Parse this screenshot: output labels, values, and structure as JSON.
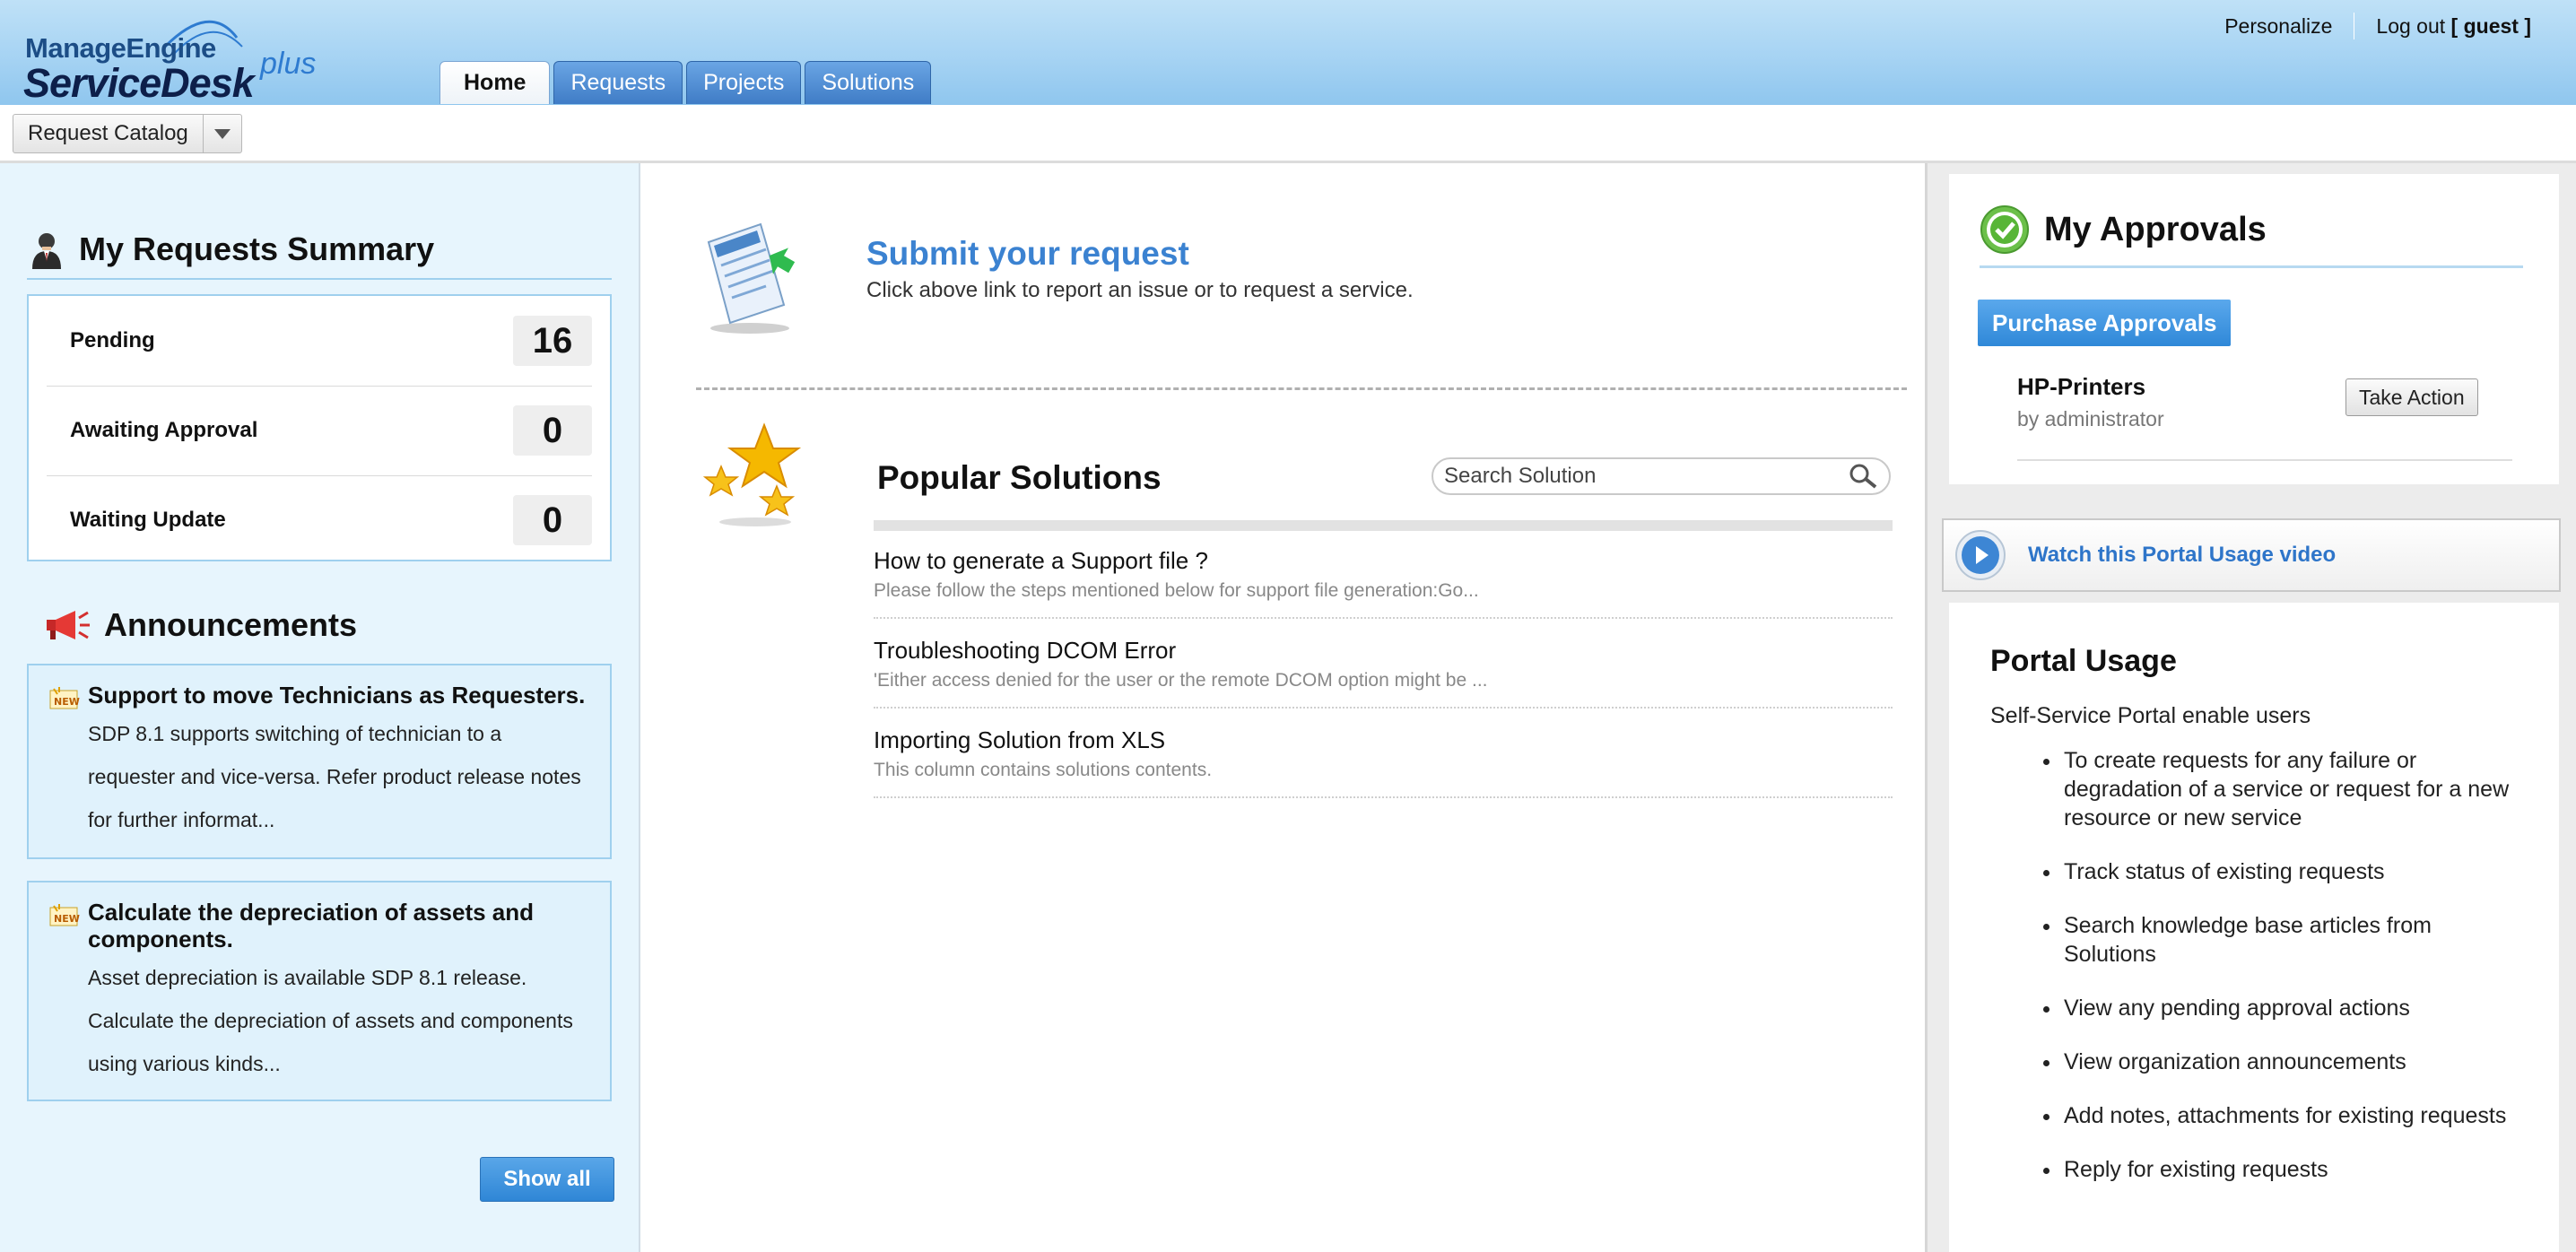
{
  "brand": {
    "line1": "ManageEngine",
    "line2": "ServiceDesk",
    "suffix": "plus"
  },
  "tabs": [
    {
      "label": "Home",
      "active": true
    },
    {
      "label": "Requests"
    },
    {
      "label": "Projects"
    },
    {
      "label": "Solutions"
    }
  ],
  "toplinks": {
    "personalize": "Personalize",
    "logout": "Log out",
    "user": "[ guest ]"
  },
  "toolbar": {
    "catalog_label": "Request Catalog"
  },
  "requests_summary": {
    "title": "My Requests Summary",
    "rows": [
      {
        "label": "Pending",
        "count": "16"
      },
      {
        "label": "Awaiting Approval",
        "count": "0"
      },
      {
        "label": "Waiting Update",
        "count": "0"
      }
    ]
  },
  "announcements": {
    "title": "Announcements",
    "items": [
      {
        "title": "Support to move Technicians as Requesters.",
        "text": "SDP 8.1 supports switching of technician to a requester and vice-versa. Refer product release notes for further informat..."
      },
      {
        "title": "Calculate the depreciation of assets and components.",
        "text": "Asset depreciation is available SDP 8.1 release. Calculate the depreciation of assets and components using various kinds..."
      }
    ],
    "show_all": "Show all"
  },
  "submit": {
    "link": "Submit your request",
    "desc": "Click above link to report an issue or to request a service."
  },
  "popular": {
    "title": "Popular Solutions",
    "search_placeholder": "Search Solution",
    "solutions": [
      {
        "title": "How to generate a Support file ?",
        "desc": "Please follow the steps mentioned below for support file generation:Go..."
      },
      {
        "title": "Troubleshooting DCOM Error",
        "desc": "'Either access denied for the user or the remote DCOM option might be ..."
      },
      {
        "title": "Importing Solution from XLS",
        "desc": "This column contains solutions contents."
      }
    ]
  },
  "approvals": {
    "title": "My Approvals",
    "button": "Purchase Approvals",
    "item_name": "HP-Printers",
    "item_by": "by administrator",
    "action": "Take Action"
  },
  "video": {
    "label": "Watch this Portal Usage video"
  },
  "usage": {
    "title": "Portal Usage",
    "desc": "Self-Service Portal enable users",
    "items": [
      "To create requests for any failure or degradation of a service or request for a new resource or new service",
      "Track status of existing requests",
      "Search knowledge base articles from Solutions",
      "View any pending approval actions",
      "View organization announcements",
      "Add notes, attachments for existing requests",
      "Reply for existing requests"
    ]
  },
  "colors": {
    "header_top": "#bfe1f7",
    "tab_blue": "#3f7cc6",
    "link_blue": "#3b82d1",
    "panel_blue": "#e7f5fd",
    "button_blue": "#2f86d6"
  }
}
